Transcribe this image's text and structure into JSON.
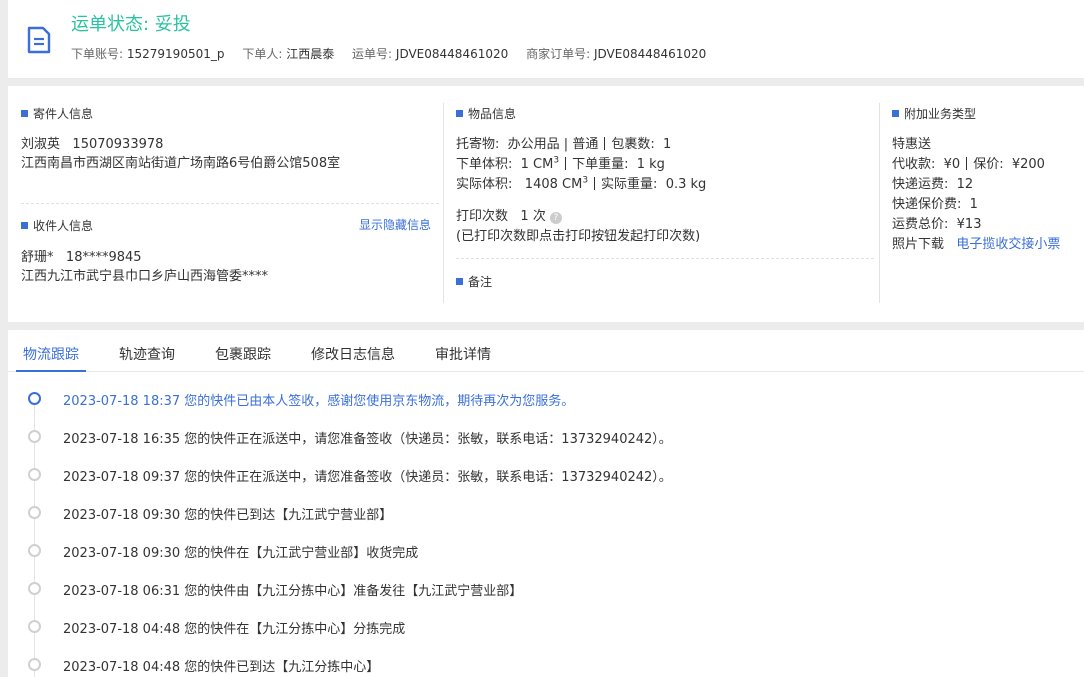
{
  "header": {
    "status": "运单状态: 妥投",
    "account_label": "下单账号:",
    "account": "15279190501_p",
    "orderer_label": "下单人:",
    "orderer": "江西晨泰",
    "waybill_label": "运单号:",
    "waybill": "JDVE08448461020",
    "merchant_order_label": "商家订单号:",
    "merchant_order": "JDVE08448461020"
  },
  "sender": {
    "title": "寄件人信息",
    "name": "刘淑英",
    "phone": "15070933978",
    "address": "江西南昌市西湖区南站街道广场南路6号伯爵公馆508室"
  },
  "receiver": {
    "title": "收件人信息",
    "show_hidden": "显示隐藏信息",
    "name": "舒珊*",
    "phone": "18****9845",
    "address": "江西九江市武宁县巾口乡庐山西海管委****"
  },
  "goods": {
    "title": "物品信息",
    "consign_label": "托寄物:",
    "consign_item": "办公用品",
    "consign_type": "普通",
    "package_count_label": "包裹数:",
    "package_count": "1",
    "order_volume_label": "下单体积:",
    "order_volume": "1 CM",
    "order_weight_label": "下单重量:",
    "order_weight": "1 kg",
    "actual_volume_label": "实际体积:",
    "actual_volume": "1408 CM",
    "actual_weight_label": "实际重量:",
    "actual_weight": "0.3 kg",
    "volume_unit_sup": "3",
    "print_label": "打印次数",
    "print_count": "1 次",
    "print_note": "(已打印次数即点击打印按钮发起打印次数)",
    "remark_title": "备注"
  },
  "addon": {
    "title": "附加业务类型",
    "service": "特惠送",
    "cod_label": "代收款:",
    "cod": "¥0",
    "insured_label": "保价:",
    "insured": "¥200",
    "freight_label": "快递运费:",
    "freight": "12",
    "insure_fee_label": "快递保价费:",
    "insure_fee": "1",
    "total_label": "运费总价:",
    "total": "¥13",
    "photo_label": "照片下载",
    "photo_link": "电子揽收交接小票"
  },
  "tabs": [
    "物流跟踪",
    "轨迹查询",
    "包裹跟踪",
    "修改日志信息",
    "审批详情"
  ],
  "timeline": [
    {
      "time": "2023-07-18 18:37",
      "text": "您的快件已由本人签收，感谢您使用京东物流，期待再次为您服务。"
    },
    {
      "time": "2023-07-18 16:35",
      "text": "您的快件正在派送中，请您准备签收（快递员：张敏，联系电话：13732940242）。"
    },
    {
      "time": "2023-07-18 09:37",
      "text": "您的快件正在派送中，请您准备签收（快递员：张敏，联系电话：13732940242）。"
    },
    {
      "time": "2023-07-18 09:30",
      "text": "您的快件已到达【九江武宁营业部】"
    },
    {
      "time": "2023-07-18 09:30",
      "text": "您的快件在【九江武宁营业部】收货完成"
    },
    {
      "time": "2023-07-18 06:31",
      "text": "您的快件由【九江分拣中心】准备发往【九江武宁营业部】"
    },
    {
      "time": "2023-07-18 04:48",
      "text": "您的快件在【九江分拣中心】分拣完成"
    },
    {
      "time": "2023-07-18 04:48",
      "text": "您的快件已到达【九江分拣中心】"
    }
  ],
  "colors": {
    "status": "#29c3a1",
    "accent": "#3a6fd8"
  }
}
